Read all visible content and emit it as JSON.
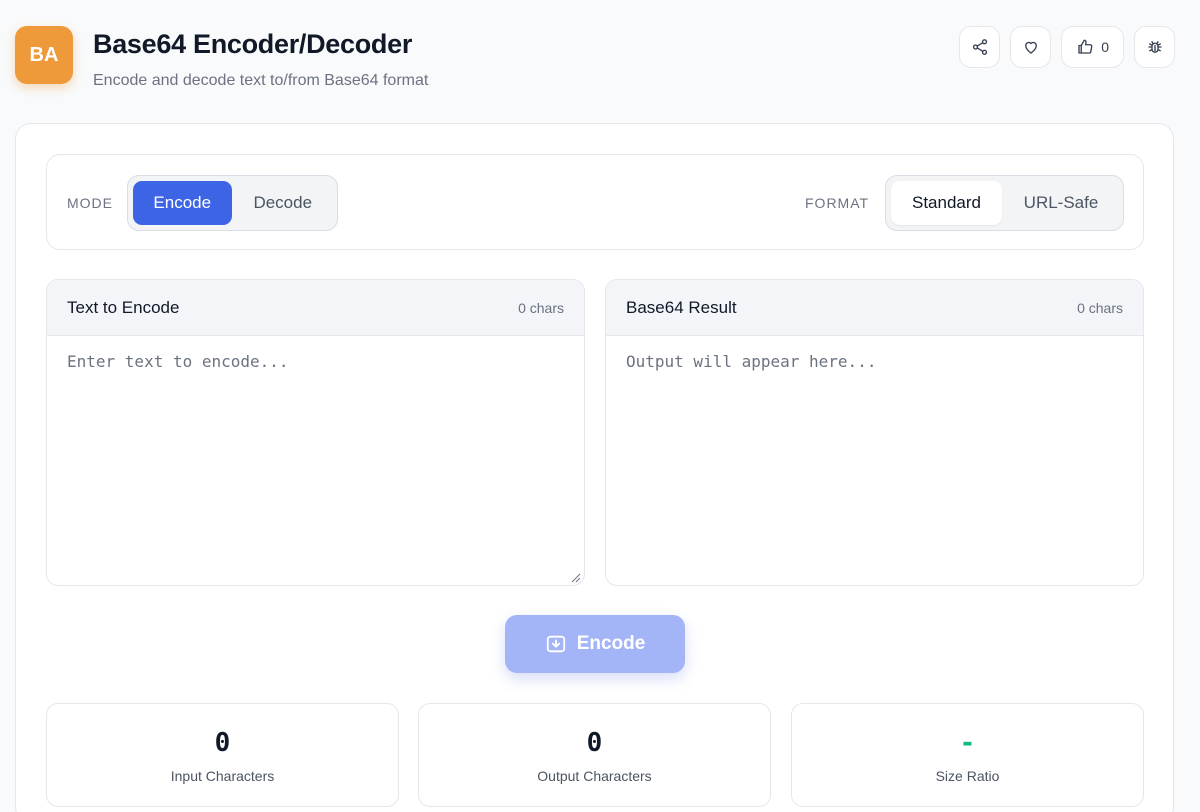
{
  "app": {
    "logo_text": "BA",
    "title": "Base64 Encoder/Decoder",
    "subtitle": "Encode and decode text to/from Base64 format",
    "like_count": "0"
  },
  "controls": {
    "mode_label": "MODE",
    "mode_options": [
      "Encode",
      "Decode"
    ],
    "mode_selected": "Encode",
    "format_label": "FORMAT",
    "format_options": [
      "Standard",
      "URL-Safe"
    ],
    "format_selected": "Standard"
  },
  "input_panel": {
    "title": "Text to Encode",
    "count": "0 chars",
    "placeholder": "Enter text to encode..."
  },
  "output_panel": {
    "title": "Base64 Result",
    "count": "0 chars",
    "placeholder": "Output will appear here..."
  },
  "action": {
    "label": "Encode"
  },
  "stats": [
    {
      "value": "0",
      "label": "Input Characters"
    },
    {
      "value": "0",
      "label": "Output Characters"
    },
    {
      "value": "-",
      "label": "Size Ratio"
    }
  ],
  "colors": {
    "accent": "#3e64e6",
    "logo": "#ee9a3a",
    "button_disabled": "#a3b4f7",
    "ratio": "#10b981"
  },
  "icons": [
    "share-icon",
    "heart-icon",
    "thumbs-up-icon",
    "bug-icon",
    "download-icon"
  ]
}
